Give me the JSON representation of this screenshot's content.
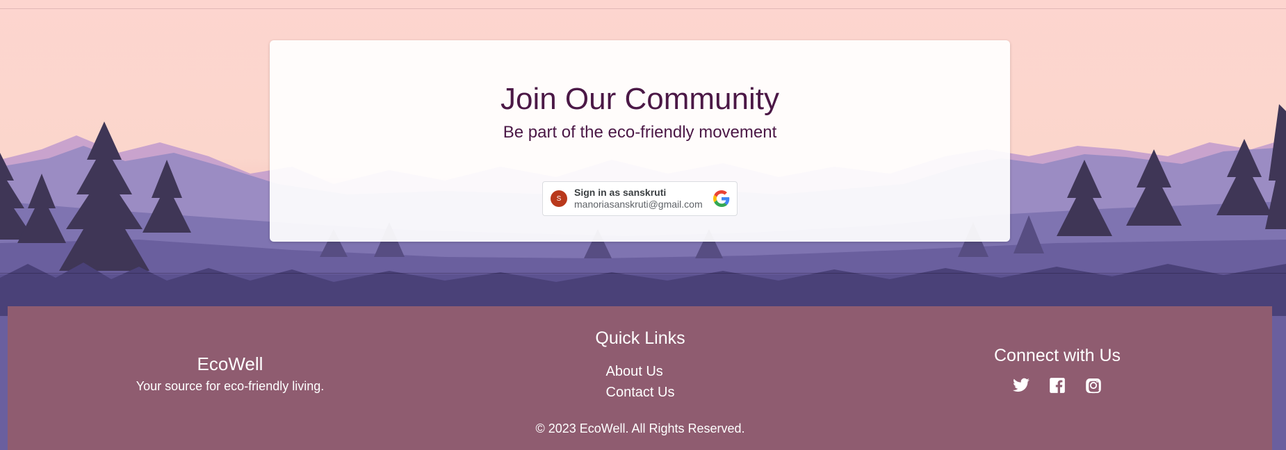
{
  "community": {
    "title": "Join Our Community",
    "subtitle": "Be part of the eco-friendly movement"
  },
  "google_signin": {
    "avatar_letter": "S",
    "label": "Sign in as sanskruti",
    "email": "manoriasanskruti@gmail.com"
  },
  "footer": {
    "brand_name": "EcoWell",
    "brand_tagline": "Your source for eco-friendly living.",
    "links_title": "Quick Links",
    "links": [
      "About Us",
      "Contact Us"
    ],
    "social_title": "Connect with Us",
    "social_icons": [
      "twitter-icon",
      "facebook-icon",
      "instagram-icon"
    ],
    "copyright": "© 2023 EcoWell. All Rights Reserved."
  },
  "colors": {
    "sky_top": "#fcd6d0",
    "title_text": "#4b1846",
    "footer_bg": "#8f5c70",
    "mountain_far": "#a894c8",
    "forest_dark": "#3a3150"
  }
}
